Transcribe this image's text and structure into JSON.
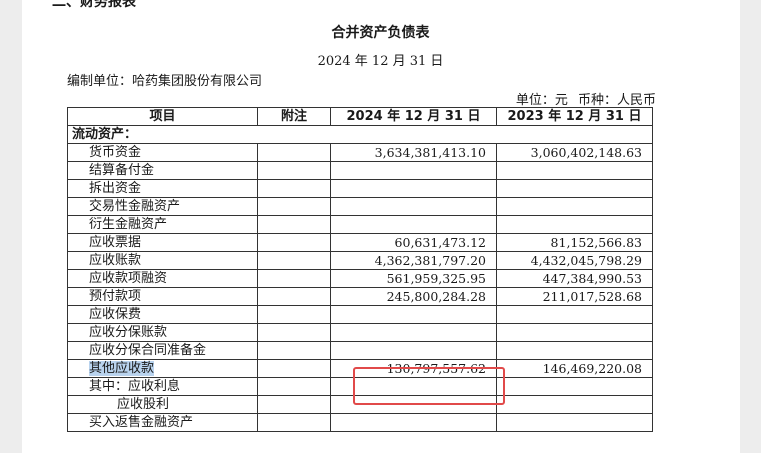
{
  "section_heading": "二、财务报表",
  "report": {
    "title": "合并资产负债表",
    "date": "2024 年 12 月 31 日",
    "company": "编制单位：哈药集团股份有限公司",
    "unit": "单位：元",
    "currency": "币种：人民币"
  },
  "table": {
    "headers": [
      "项目",
      "附注",
      "2024 年 12 月 31 日",
      "2023 年 12 月 31 日"
    ],
    "section_label": "流动资产：",
    "rows": [
      {
        "item": "货币资金",
        "note": "",
        "current": "3,634,381,413.10",
        "prior": "3,060,402,148.63"
      },
      {
        "item": "结算备付金",
        "note": "",
        "current": "",
        "prior": ""
      },
      {
        "item": "拆出资金",
        "note": "",
        "current": "",
        "prior": ""
      },
      {
        "item": "交易性金融资产",
        "note": "",
        "current": "",
        "prior": ""
      },
      {
        "item": "衍生金融资产",
        "note": "",
        "current": "",
        "prior": ""
      },
      {
        "item": "应收票据",
        "note": "",
        "current": "60,631,473.12",
        "prior": "81,152,566.83"
      },
      {
        "item": "应收账款",
        "note": "",
        "current": "4,362,381,797.20",
        "prior": "4,432,045,798.29"
      },
      {
        "item": "应收款项融资",
        "note": "",
        "current": "561,959,325.95",
        "prior": "447,384,990.53"
      },
      {
        "item": "预付款项",
        "note": "",
        "current": "245,800,284.28",
        "prior": "211,017,528.68"
      },
      {
        "item": "应收保费",
        "note": "",
        "current": "",
        "prior": ""
      },
      {
        "item": "应收分保账款",
        "note": "",
        "current": "",
        "prior": ""
      },
      {
        "item": "应收分保合同准备金",
        "note": "",
        "current": "",
        "prior": ""
      },
      {
        "item": "其他应收款",
        "note": "",
        "current": "130,797,557.62",
        "prior": "146,469,220.08"
      },
      {
        "item": "其中：应收利息",
        "note": "",
        "current": "",
        "prior": ""
      },
      {
        "item": "应收股利",
        "note": "",
        "current": "",
        "prior": ""
      },
      {
        "item": "买入返售金融资产",
        "note": "",
        "current": "",
        "prior": ""
      }
    ]
  },
  "highlight_color": "#b9d3ee",
  "annotation_box_color": "#e14a4a"
}
